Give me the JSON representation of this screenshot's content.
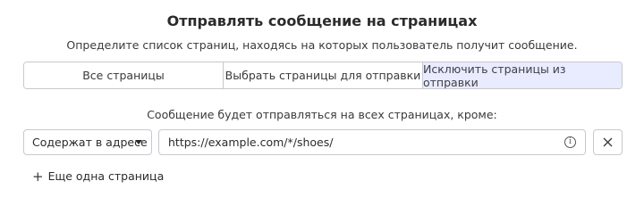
{
  "header": {
    "title": "Отправлять сообщение на страницах",
    "subtitle": "Определите список страниц, находясь на которых пользователь получит сообщение."
  },
  "tabs": [
    {
      "label": "Все страницы",
      "active": false
    },
    {
      "label": "Выбрать страницы для отправки",
      "active": false
    },
    {
      "label": "Исключить страницы из отправки",
      "active": true
    }
  ],
  "rule": {
    "caption": "Сообщение будет отправляться на всех страницах, кроме:",
    "condition_selected": "Содержат в адресе",
    "url_value": "https://example.com/*/shoes/"
  },
  "add_page_label": "Еще одна страница",
  "colors": {
    "active_tab_bg": "#e9ebff",
    "border": "#c8c8d0"
  }
}
